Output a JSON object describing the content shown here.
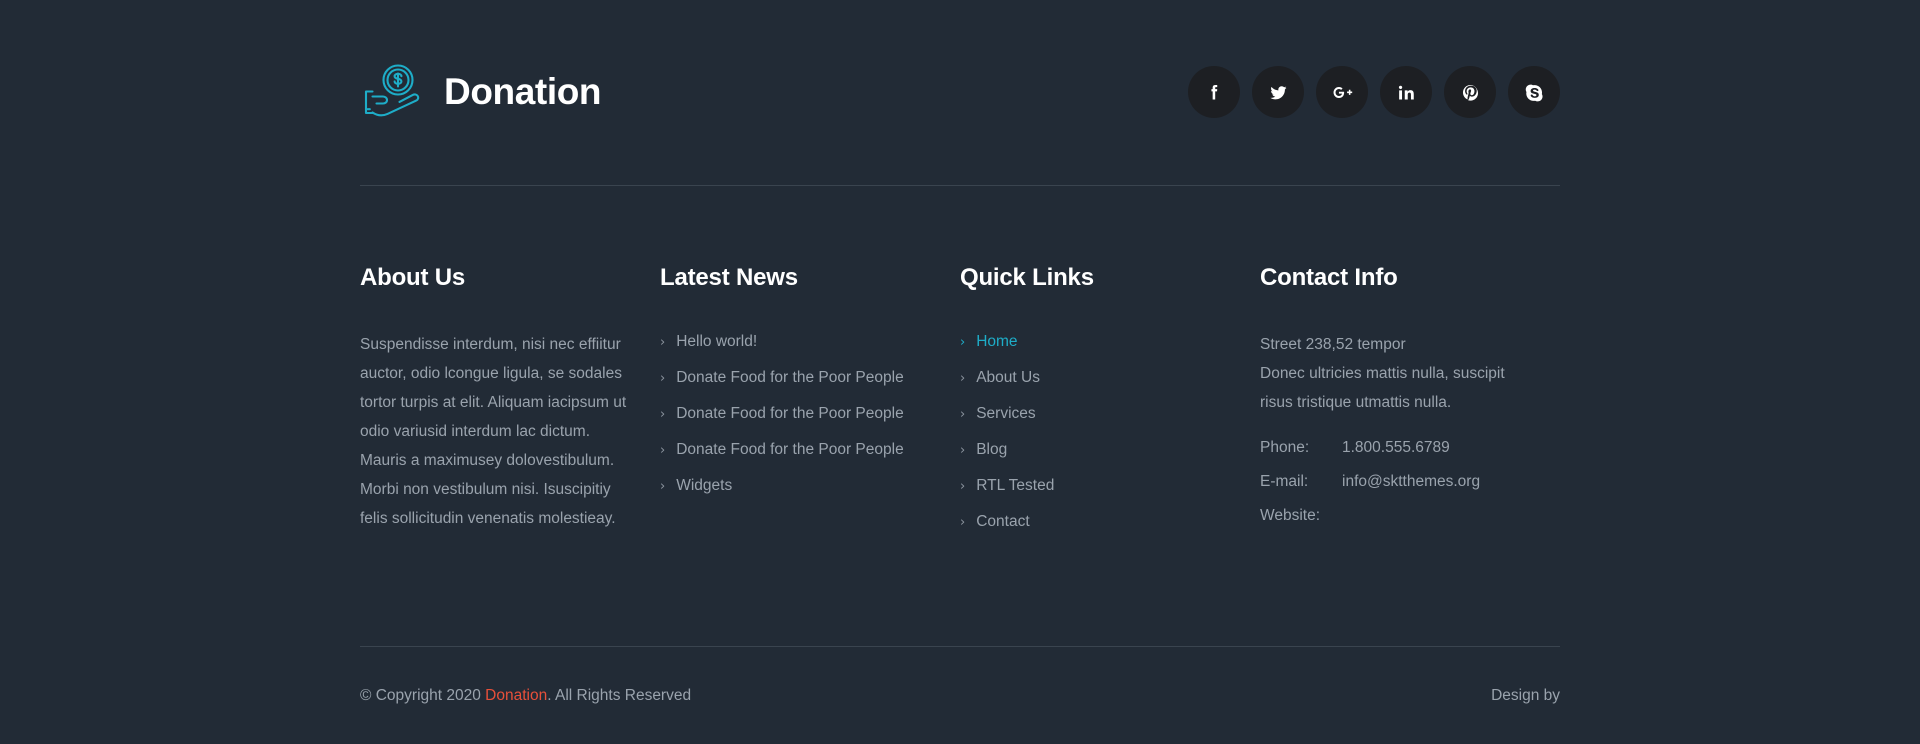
{
  "colors": {
    "background": "#222b36",
    "accent_cyan": "#1eadc8",
    "accent_red": "#e8503a",
    "text_muted": "#9aa3ad",
    "divider": "#3a444f",
    "social_bg": "#1d1f23"
  },
  "brand": {
    "name": "Donation",
    "logo_icon": "hand-holding-dollar-coin-icon"
  },
  "social": [
    {
      "name": "facebook",
      "icon": "facebook-icon",
      "label": "f"
    },
    {
      "name": "twitter",
      "icon": "twitter-icon",
      "label": "Twitter"
    },
    {
      "name": "google-plus",
      "icon": "google-plus-icon",
      "label": "G+"
    },
    {
      "name": "linkedin",
      "icon": "linkedin-icon",
      "label": "in"
    },
    {
      "name": "pinterest",
      "icon": "pinterest-icon",
      "label": "Pinterest"
    },
    {
      "name": "skype",
      "icon": "skype-icon",
      "label": "Skype"
    }
  ],
  "columns": {
    "about": {
      "title": "About Us",
      "text": "Suspendisse interdum, nisi nec effiitur auctor, odio lcongue ligula, se sodales tortor turpis at elit. Aliquam iacipsum ut odio variusid interdum lac dictum. Mauris a maximusey dolovestibulum. Morbi non vestibulum nisi. Isuscipitiy felis sollicitudin venenatis molestieay."
    },
    "news": {
      "title": "Latest News",
      "items": [
        {
          "label": "Hello world!",
          "active": false
        },
        {
          "label": "Donate Food for the Poor People",
          "active": false
        },
        {
          "label": "Donate Food for the Poor People",
          "active": false
        },
        {
          "label": "Donate Food for the Poor People",
          "active": false
        },
        {
          "label": "Widgets",
          "active": false
        }
      ]
    },
    "quick_links": {
      "title": "Quick Links",
      "items": [
        {
          "label": "Home",
          "active": true
        },
        {
          "label": "About Us",
          "active": false
        },
        {
          "label": "Services",
          "active": false
        },
        {
          "label": "Blog",
          "active": false
        },
        {
          "label": "RTL Tested",
          "active": false
        },
        {
          "label": "Contact",
          "active": false
        }
      ]
    },
    "contact": {
      "title": "Contact Info",
      "address": "Street 238,52 tempor\nDonec ultricies mattis nulla, suscipit\nrisus tristique utmattis nulla.",
      "rows": [
        {
          "label": "Phone:",
          "value": "1.800.555.6789"
        },
        {
          "label": "E-mail:",
          "value": "info@sktthemes.org"
        },
        {
          "label": "Website:",
          "value": ""
        }
      ]
    }
  },
  "bottom": {
    "copyright_prefix": "© Copyright 2020 ",
    "copyright_accent": "Donation",
    "copyright_suffix": ". All Rights Reserved",
    "design_by": "Design by"
  },
  "chevron_glyph": "›"
}
